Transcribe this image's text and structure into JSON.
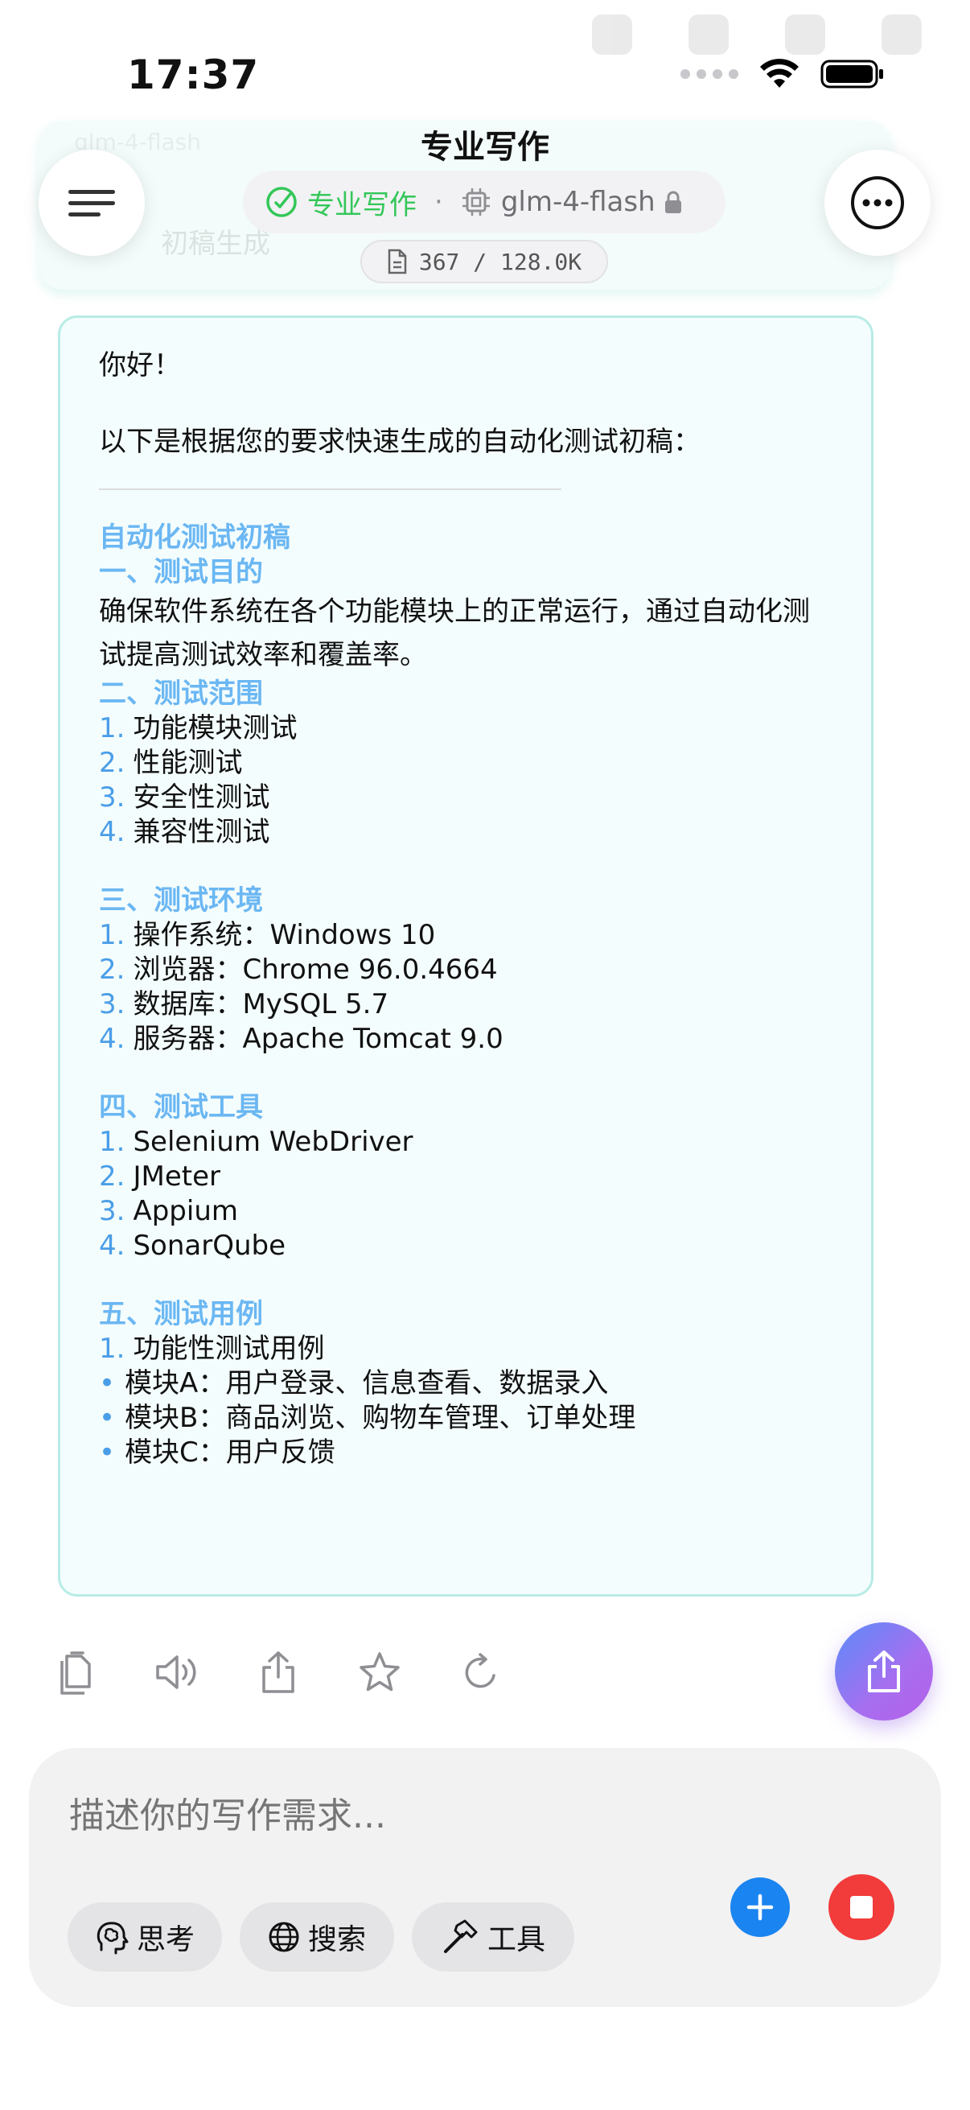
{
  "status_bar": {
    "time": "17:37"
  },
  "background": {
    "ghost_model_text": "glm-4-flash",
    "ghost_card_text": "初稿生成"
  },
  "header": {
    "title": "专业写作",
    "mode_label": "专业写作",
    "separator": "·",
    "model_label": "glm-4-flash",
    "token_count": "367 / 128.0K",
    "menu_icon": "hamburger-menu-icon",
    "more_icon": "more-horizontal-icon"
  },
  "message": {
    "greeting": "你好！",
    "intro": "以下是根据您的要求快速生成的自动化测试初稿：",
    "doc_title": "自动化测试初稿",
    "sections": [
      {
        "heading": "一、测试目的",
        "body": "确保软件系统在各个功能模块上的正常运行，通过自动化测试提高测试效率和覆盖率。"
      },
      {
        "heading": "二、测试范围",
        "items": [
          "功能模块测试",
          "性能测试",
          "安全性测试",
          "兼容性测试"
        ]
      },
      {
        "heading": "三、测试环境",
        "items": [
          "操作系统：Windows 10",
          "浏览器：Chrome 96.0.4664",
          "数据库：MySQL 5.7",
          "服务器：Apache Tomcat 9.0"
        ]
      },
      {
        "heading": "四、测试工具",
        "items": [
          "Selenium WebDriver",
          "JMeter",
          "Appium",
          "SonarQube"
        ]
      },
      {
        "heading": "五、测试用例",
        "items": [
          "功能性测试用例"
        ],
        "bullets": [
          "模块A：用户登录、信息查看、数据录入",
          "模块B：商品浏览、购物车管理、订单处理",
          "模块C：用户反馈"
        ]
      }
    ]
  },
  "numbering": [
    "1.",
    "2.",
    "3.",
    "4."
  ],
  "bullet_symbol": "•",
  "actions": {
    "icons": [
      "copy-icon",
      "speaker-icon",
      "share-icon",
      "star-icon",
      "refresh-icon"
    ]
  },
  "input": {
    "placeholder": "描述你的写作需求...",
    "chips": {
      "think": "思考",
      "search": "搜索",
      "tools": "工具"
    }
  },
  "colors": {
    "accent_blue": "#6bb7f3",
    "mode_green": "#34c759",
    "card_border": "#b8ece6",
    "add_button": "#1a84f0",
    "stop_button": "#f23b3b"
  }
}
